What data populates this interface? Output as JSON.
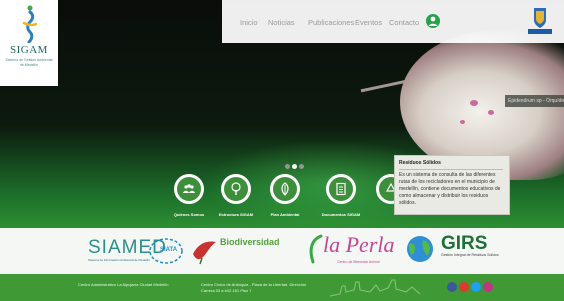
{
  "brand": {
    "name": "SIGAM",
    "subtitle": "Sistema de Gestión Ambiental de Medellín"
  },
  "nav": {
    "items": [
      "Inicio",
      "Noticias",
      "Publicaciones",
      "Eventos",
      "Contacto"
    ]
  },
  "crest": {
    "label": "Alcaldía de Medellín"
  },
  "hero": {
    "caption": "Epidendrum sp - Orquídea"
  },
  "carousel": {
    "dots": 3,
    "active": 1
  },
  "features": [
    {
      "label": "Quiénes Somos",
      "icon": "group-icon"
    },
    {
      "label": "Estructura SIGAM",
      "icon": "tree-icon"
    },
    {
      "label": "Plan Ambiental",
      "icon": "leaf-icon"
    },
    {
      "label": "Documentos SIGAM",
      "icon": "document-icon"
    },
    {
      "label": "Residuos Sólidos",
      "icon": "recycle-icon"
    }
  ],
  "tooltip": {
    "title": "Residuos Sólidos",
    "body": "Es un sistema de consulta de las diferentes rutas de los recicladores en el municipio de medellín, contiene documentos educativos de como almacenar y distribuir los residuos sólidos."
  },
  "partners": {
    "siamed": "SIAMED",
    "siamed_sub": "Sistema de Información Ambiental de Medellín",
    "siata": "SIATA",
    "biodiversidad": "Biodiversidad",
    "perla": "la Perla",
    "perla_sub": "Centro de Bienestar Animal",
    "girs": "GIRS",
    "girs_sub": "Gestión Integral de Residuos Sólidos"
  },
  "footer": {
    "address1": "Centro Administrativo La Alpujarra Ciudad Medellín",
    "address2_line1": "Centro Cívico de Antioquia - Plaza de la Libertad. Dirección",
    "address2_line2": "Carrera 53 a #42-161 Piso 7"
  },
  "colors": {
    "accent": "#3f9a36",
    "footer": "#3f9a36",
    "brand_teal": "#1d6a63"
  }
}
